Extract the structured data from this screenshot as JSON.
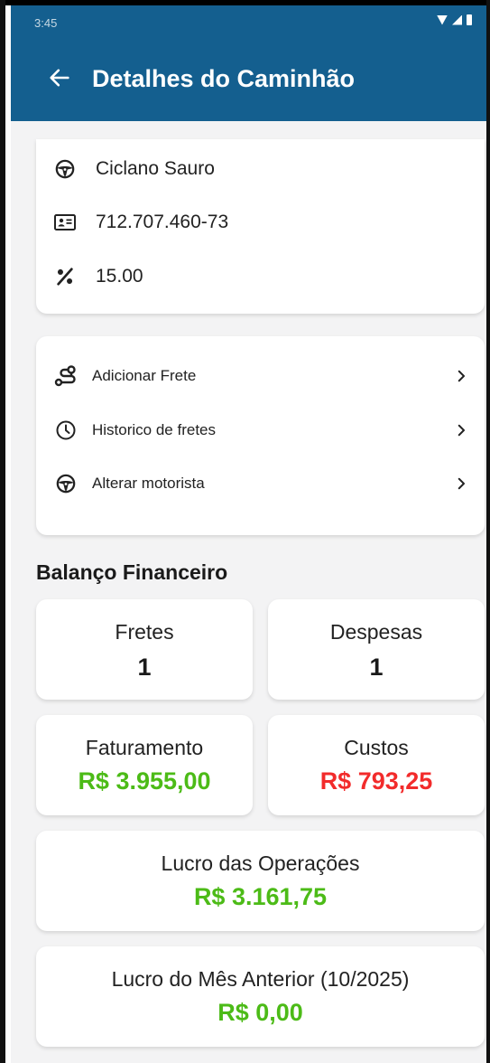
{
  "status_bar": {
    "time": "3:45"
  },
  "app_bar": {
    "title": "Detalhes do Caminhão"
  },
  "driver": {
    "name": "Ciclano Sauro",
    "document": "712.707.460-73",
    "percentage": "15.00"
  },
  "menu": {
    "items": [
      {
        "label": "Adicionar Frete",
        "icon": "route-icon"
      },
      {
        "label": "Historico de fretes",
        "icon": "clock-icon"
      },
      {
        "label": "Alterar motorista",
        "icon": "steering-wheel-icon"
      }
    ]
  },
  "finance": {
    "section_title": "Balanço Financeiro",
    "fretes": {
      "label": "Fretes",
      "value": "1"
    },
    "despesas": {
      "label": "Despesas",
      "value": "1"
    },
    "faturamento": {
      "label": "Faturamento",
      "value": "R$ 3.955,00"
    },
    "custos": {
      "label": "Custos",
      "value": "R$ 793,25"
    },
    "lucro_operacoes": {
      "label": "Lucro das Operações",
      "value": "R$ 3.161,75"
    },
    "lucro_mes_anterior": {
      "label": "Lucro do Mês Anterior (10/2025)",
      "value": "R$ 0,00"
    }
  },
  "colors": {
    "app_bar": "#145f8f",
    "positive": "#4cbb17",
    "negative": "#f22b2b",
    "background": "#f3f3f4"
  }
}
